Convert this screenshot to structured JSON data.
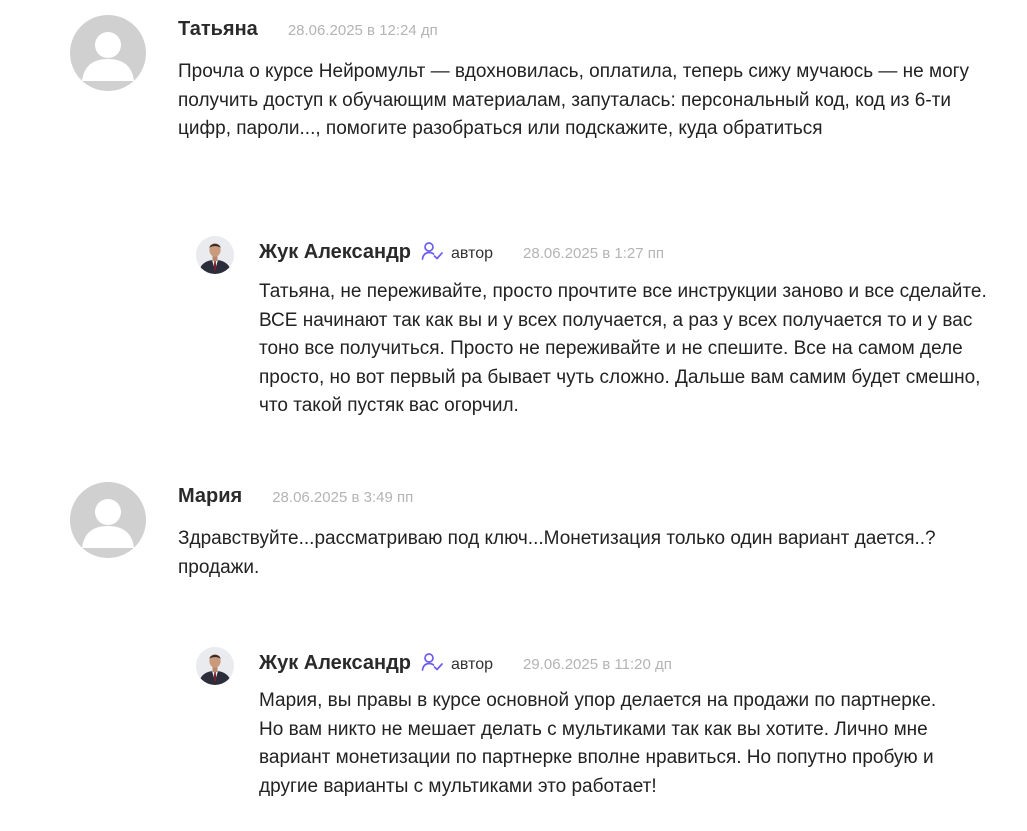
{
  "comments": [
    {
      "author": "Татьяна",
      "date": "28.06.2025 в 12:24 дп",
      "avatar": "default-user-avatar",
      "text": "Прочла о курсе Нейромульт — вдохновилась, оплатила, теперь сижу мучаюсь — не могу получить доступ к обучающим материалам, запуталась: персональный код, код из 6-ти цифр, пароли..., помогите разобраться или подскажите, куда обратиться"
    },
    {
      "author": "Жук Александр",
      "role": "автор",
      "role_icon": "author-badge-icon",
      "date": "28.06.2025 в 1:27 пп",
      "avatar": "author-photo-avatar",
      "text": "Татьяна, не переживайте, просто прочтите все инструкции заново и все сделайте. ВСЕ начинают так как вы и у всех получается, а раз у всех получается то и у вас тоно все получиться. Просто не переживайте и не спешите. Все на самом деле просто, но вот первый ра бывает чуть сложно. Дальше вам самим будет смешно, что такой пустяк вас огорчил."
    },
    {
      "author": "Мария",
      "date": "28.06.2025 в 3:49 пп",
      "avatar": "default-user-avatar",
      "text": "Здравствуйте...рассматриваю под ключ...Монетизация только один вариант дается..? продажи."
    },
    {
      "author": "Жук Александр",
      "role": "автор",
      "role_icon": "author-badge-icon",
      "date": "29.06.2025 в 11:20 дп",
      "avatar": "author-photo-avatar",
      "text": "Мария, вы правы в курсе основной упор делается на продажи по партнерке. Но вам никто не мешает делать с мультиками так как вы хотите. Лично мне вариант монетизации по партнерке вполне нравиться. Но попутно пробую и другие варианты с мультиками это работает!"
    }
  ],
  "colors": {
    "author_icon": "#6b5cf0",
    "date": "#b4b4b4",
    "avatar_placeholder": "#d0d0d0"
  }
}
